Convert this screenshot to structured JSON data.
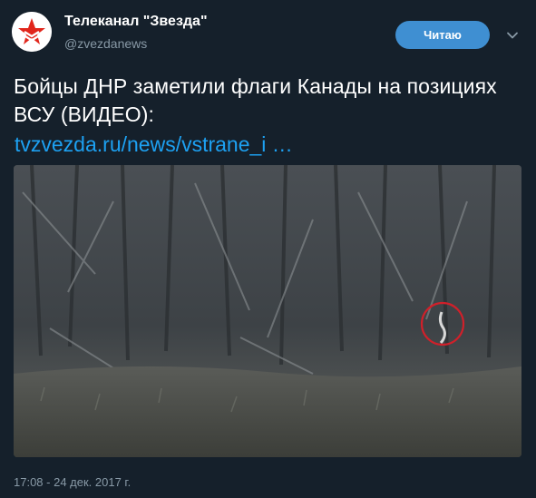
{
  "account": {
    "display_name": "Телеканал \"Звезда\"",
    "handle": "@zvezdanews",
    "avatar_icon": "zvezda-star-logo"
  },
  "actions": {
    "follow_label": "Читаю",
    "menu_icon": "chevron-down-icon"
  },
  "tweet": {
    "text": "Бойцы ДНР заметили флаги Канады на позициях ВСУ (ВИДЕО):",
    "link_text": "tvzvezda.ru/news/vstrane_i …",
    "timestamp": "17:08 - 24 дек. 2017 г."
  },
  "colors": {
    "background": "#15202b",
    "accent": "#1da1f2",
    "button": "#3f8fd2",
    "secondary_text": "#8899a6",
    "highlight_circle": "#d0202a"
  }
}
